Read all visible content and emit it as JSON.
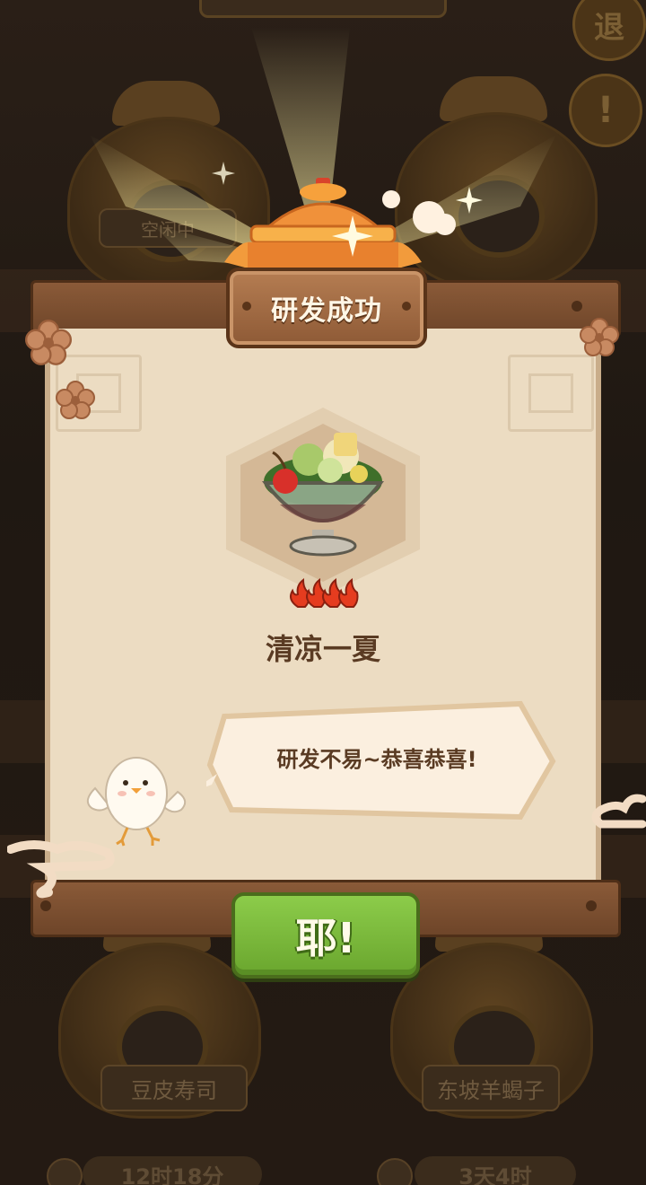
{
  "dialog": {
    "title": "研发成功",
    "dish_name": "清凉一夏",
    "heat_level": 4,
    "speech": "研发不易~恭喜恭喜!",
    "confirm_label": "耶!"
  },
  "top_right_button_label": "退",
  "background": {
    "pots": [
      {
        "name": "豆皮寿司",
        "timer": "12时18分"
      },
      {
        "name": "东坡羊蝎子",
        "timer": "3天4时"
      }
    ],
    "top_pot_label": "空闲中"
  },
  "colors": {
    "panel_wood": "#8a5a38",
    "paper": "#ecdcc2",
    "confirm_green": "#7bbd3c",
    "title_text": "#fff6e6",
    "dish_text": "#5a3b23"
  }
}
